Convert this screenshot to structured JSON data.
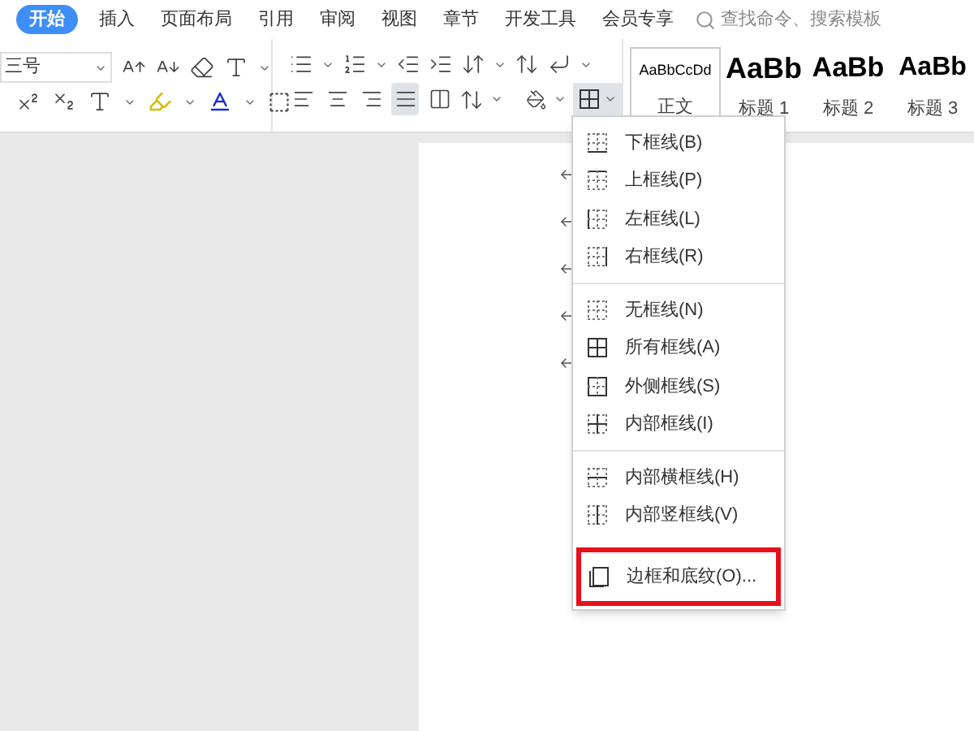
{
  "tabs": [
    {
      "label": "开始",
      "selected": true
    },
    {
      "label": "插入",
      "selected": false
    },
    {
      "label": "页面布局",
      "selected": false
    },
    {
      "label": "引用",
      "selected": false
    },
    {
      "label": "审阅",
      "selected": false
    },
    {
      "label": "视图",
      "selected": false
    },
    {
      "label": "章节",
      "selected": false
    },
    {
      "label": "开发工具",
      "selected": false
    },
    {
      "label": "会员专享",
      "selected": false
    }
  ],
  "search": {
    "placeholder": "查找命令、搜索模板"
  },
  "font_size": {
    "value": "三号"
  },
  "alignment": [
    {
      "kind": "left",
      "selected": false
    },
    {
      "kind": "center",
      "selected": false
    },
    {
      "kind": "right",
      "selected": false
    },
    {
      "kind": "justify",
      "selected": true
    },
    {
      "kind": "distributed",
      "selected": false
    }
  ],
  "border_button": {
    "open": true
  },
  "styles": [
    {
      "preview": "AaBbCcDd",
      "label": "正文",
      "kind": "normal"
    },
    {
      "preview": "AaBb",
      "label": "标题 1",
      "kind": "h1"
    },
    {
      "preview": "AaBb",
      "label": "标题 2",
      "kind": "h2"
    },
    {
      "preview": "AaBb",
      "label": "标题 3",
      "kind": "h3"
    }
  ],
  "border_menu": {
    "sections": [
      {
        "items": [
          {
            "label": "下框线(B)",
            "kind": "bottom"
          },
          {
            "label": "上框线(P)",
            "kind": "top"
          },
          {
            "label": "左框线(L)",
            "kind": "left"
          },
          {
            "label": "右框线(R)",
            "kind": "right"
          }
        ]
      },
      {
        "items": [
          {
            "label": "无框线(N)",
            "kind": "none"
          },
          {
            "label": "所有框线(A)",
            "kind": "all"
          },
          {
            "label": "外侧框线(S)",
            "kind": "outside"
          },
          {
            "label": "内部框线(I)",
            "kind": "inside"
          }
        ]
      },
      {
        "items": [
          {
            "label": "内部横框线(H)",
            "kind": "inside_h"
          },
          {
            "label": "内部竖框线(V)",
            "kind": "inside_v"
          }
        ]
      }
    ],
    "footer": {
      "label": "边框和底纹(O)...",
      "kind": "dialog",
      "highlighted": true
    }
  }
}
